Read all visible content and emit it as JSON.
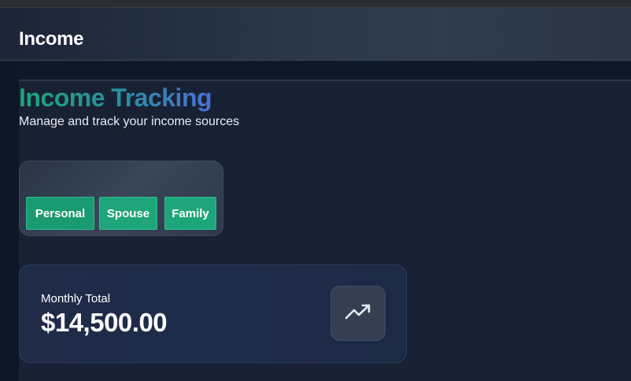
{
  "header": {
    "title": "Income"
  },
  "page": {
    "title": "Income Tracking",
    "subtitle": "Manage and track your income sources"
  },
  "tabs": [
    {
      "label": "Personal",
      "active": true
    },
    {
      "label": "Spouse",
      "active": false
    },
    {
      "label": "Family",
      "active": false
    }
  ],
  "summary": {
    "label": "Monthly Total",
    "value": "$14,500.00",
    "icon": "trending-up-icon"
  },
  "colors": {
    "accent_green": "#1fa57a",
    "title_gradient_start": "#1ea37a",
    "title_gradient_end": "#4a6fd6",
    "background": "#131b2c"
  }
}
